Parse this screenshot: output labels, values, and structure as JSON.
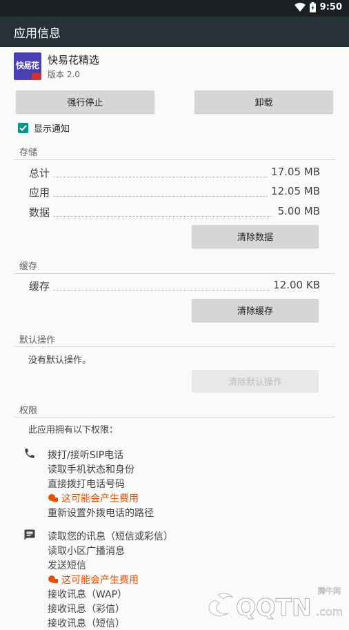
{
  "status_bar": {
    "time": "9:50",
    "icons": [
      "wifi-icon",
      "battery-icon"
    ]
  },
  "app_bar": {
    "title": "应用信息"
  },
  "app": {
    "name": "快易花精选",
    "version": "版本 2.0",
    "icon_text": "快易花"
  },
  "buttons": {
    "force_stop": "强行停止",
    "uninstall": "卸载",
    "clear_data": "清除数据",
    "clear_cache": "清除缓存",
    "clear_defaults": "清除默认操作"
  },
  "notifications": {
    "label": "显示通知",
    "checked": true
  },
  "storage": {
    "title": "存储",
    "rows": [
      {
        "label": "总计",
        "value": "17.05 MB"
      },
      {
        "label": "应用",
        "value": "12.05 MB"
      },
      {
        "label": "数据",
        "value": "5.00 MB"
      }
    ]
  },
  "cache": {
    "title": "缓存",
    "label": "缓存",
    "value": "12.00 KB"
  },
  "defaults": {
    "title": "默认操作",
    "text": "没有默认操作。"
  },
  "permissions": {
    "title": "权限",
    "intro": "此应用拥有以下权限：",
    "phone_group": [
      "拨打/接听SIP电话",
      "读取手机状态和身份",
      "直接拨打电话号码",
      "这可能会产生费用",
      "重新设置外拨电话的路径"
    ],
    "sms_group": [
      "读取您的讯息（短信或彩信）",
      "读取小区广播消息",
      "发送短信",
      "这可能会产生费用",
      "接收讯息（WAP）",
      "接收讯息（彩信）",
      "接收讯息（短信）"
    ]
  },
  "watermark": {
    "brand": "QQTN",
    "suffix": ".com",
    "cn": "腾牛网"
  },
  "colors": {
    "app_bar": "#263238",
    "status_bar": "#1b1f22",
    "accent": "#009688",
    "warning": "#e65100"
  }
}
